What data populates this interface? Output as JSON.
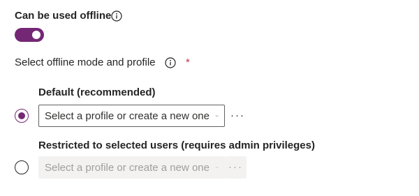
{
  "offline": {
    "label": "Can be used offline",
    "info_icon": "info-icon",
    "toggle_on": true,
    "accent_color": "#742774"
  },
  "mode": {
    "label": "Select offline mode and profile",
    "info_icon": "info-icon",
    "required_mark": "*",
    "required_color": "#c4314b"
  },
  "options": [
    {
      "label": "Default (recommended)",
      "selected": true,
      "dropdown_placeholder": "Select a profile or create a new one",
      "more_label": "···",
      "enabled": true
    },
    {
      "label": "Restricted to selected users (requires admin privileges)",
      "selected": false,
      "dropdown_placeholder": "Select a profile or create a new one",
      "more_label": "···",
      "enabled": false
    }
  ]
}
